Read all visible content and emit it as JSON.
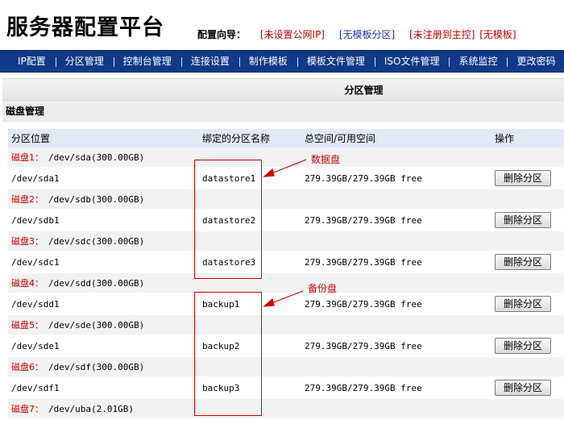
{
  "app": {
    "title": "服务器配置平台"
  },
  "wizard": {
    "label": "配置向导：",
    "links": [
      "[未设置公网IP]",
      "[无模板分区]",
      "[未注册到主控]",
      "[无模板]"
    ]
  },
  "nav": {
    "items": [
      "IP配置",
      "分区管理",
      "控制台管理",
      "连接设置",
      "制作模板",
      "模板文件管理",
      "ISO文件管理",
      "系统监控",
      "更改密码"
    ]
  },
  "panel": {
    "title": "分区管理"
  },
  "section": {
    "title": "磁盘管理"
  },
  "table": {
    "headers": [
      "分区位置",
      "绑定的分区名称",
      "总空间/可用空间",
      "操作"
    ],
    "disks": [
      {
        "label": "磁盘1：",
        "device": "/dev/sda(300.00GB)",
        "partition": "/dev/sda1",
        "name": "datastore1",
        "space": "279.39GB/279.39GB free",
        "action": "删除分区"
      },
      {
        "label": "磁盘2：",
        "device": "/dev/sdb(300.00GB)",
        "partition": "/dev/sdb1",
        "name": "datastore2",
        "space": "279.39GB/279.39GB free",
        "action": "删除分区"
      },
      {
        "label": "磁盘3：",
        "device": "/dev/sdc(300.00GB)",
        "partition": "/dev/sdc1",
        "name": "datastore3",
        "space": "279.39GB/279.39GB free",
        "action": "删除分区"
      },
      {
        "label": "磁盘4：",
        "device": "/dev/sdd(300.00GB)",
        "partition": "/dev/sdd1",
        "name": "backup1",
        "space": "279.39GB/279.39GB free",
        "action": "删除分区"
      },
      {
        "label": "磁盘5：",
        "device": "/dev/sde(300.00GB)",
        "partition": "/dev/sde1",
        "name": "backup2",
        "space": "279.39GB/279.39GB free",
        "action": "删除分区"
      },
      {
        "label": "磁盘6：",
        "device": "/dev/sdf(300.00GB)",
        "partition": "/dev/sdf1",
        "name": "backup3",
        "space": "279.39GB/279.39GB free",
        "action": "删除分区"
      },
      {
        "label": "磁盘7：",
        "device": "/dev/uba(2.01GB)"
      }
    ]
  },
  "annotations": {
    "datastore_label": "数据盘",
    "backup_label": "备份盘",
    "color": "#d40000"
  }
}
